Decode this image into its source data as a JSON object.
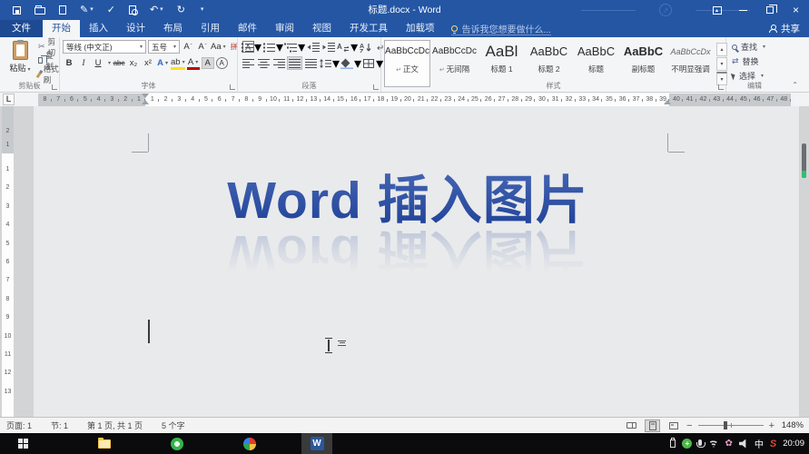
{
  "window": {
    "title": "标题.docx - Word",
    "qat_icons": [
      "save",
      "open",
      "new-document",
      "ink-signature",
      "spelling-check",
      "print-preview",
      "undo",
      "redo",
      "customize-quick-access"
    ],
    "controls": [
      "ribbon-display-options",
      "minimize",
      "restore-down",
      "close"
    ]
  },
  "tabs": {
    "file": "文件",
    "active": "开始",
    "items": [
      "开始",
      "插入",
      "设计",
      "布局",
      "引用",
      "邮件",
      "审阅",
      "视图",
      "开发工具",
      "加载项"
    ],
    "tell_me": "告诉我您想要做什么...",
    "share": "共享"
  },
  "ribbon": {
    "clipboard": {
      "label": "剪贴板",
      "paste": "粘贴",
      "cut": "剪切",
      "copy": "复制",
      "format_painter": "格式刷"
    },
    "font": {
      "label": "字体",
      "font_name": "等线 (中文正)",
      "font_size": "五号",
      "buttons": {
        "grow": "A",
        "shrink": "A",
        "change_case": "Aa",
        "phonetic": "拼",
        "char_border": "A",
        "bold": "B",
        "italic": "I",
        "underline": "U",
        "strikethrough": "abc",
        "subscript": "x₂",
        "superscript": "x²",
        "text_effects": "A",
        "highlight": "ab",
        "font_color": "A",
        "char_shading": "A",
        "enclose": "A"
      }
    },
    "paragraph": {
      "label": "段落"
    },
    "styles": {
      "label": "样式",
      "items": [
        {
          "preview": "AaBbCcDc",
          "name": "正文",
          "selected": true
        },
        {
          "preview": "AaBbCcDc",
          "name": "无间隔",
          "selected": false
        },
        {
          "preview": "AaBl",
          "name": "标题 1",
          "selected": false
        },
        {
          "preview": "AaBbC",
          "name": "标题 2",
          "selected": false
        },
        {
          "preview": "AaBbC",
          "name": "标题",
          "selected": false
        },
        {
          "preview": "AaBbC",
          "name": "副标题",
          "selected": false
        },
        {
          "preview": "AaBbCcDx",
          "name": "不明显强调",
          "selected": false
        }
      ]
    },
    "editing": {
      "label": "编辑",
      "find": "查找",
      "replace": "替换",
      "select": "选择"
    }
  },
  "ruler": {
    "left_margin": [
      8,
      7,
      6,
      5,
      4,
      3,
      2,
      1
    ],
    "text_area": [
      1,
      2,
      3,
      4,
      5,
      6,
      7,
      8,
      9,
      10,
      11,
      12,
      13,
      14,
      15,
      16,
      17,
      18,
      19,
      20,
      21,
      22,
      23,
      24,
      25,
      26,
      27,
      28,
      29,
      30,
      31,
      32,
      33,
      34,
      35,
      36,
      37,
      38,
      39
    ],
    "right_margin": [
      40,
      41,
      42,
      43,
      44,
      45,
      46,
      47,
      48
    ],
    "v_margin": [
      2,
      1
    ],
    "v_text": [
      1,
      2,
      3,
      4,
      5,
      6,
      7,
      8,
      9,
      10,
      11,
      12,
      13
    ]
  },
  "document": {
    "title": "Word 插入图片",
    "title_color_top": "#4b6cb8",
    "title_color_bottom": "#1d3f96"
  },
  "status": {
    "page_label": "页面: 1",
    "section": "节: 1",
    "pages": "第 1 页, 共 1 页",
    "words": "5 个字",
    "views": [
      "read-mode",
      "print-layout",
      "web-layout"
    ],
    "zoom_out": "−",
    "zoom_in": "+",
    "zoom": "148%"
  },
  "taskbar": {
    "apps": [
      "start",
      "file-explorer",
      "security-app",
      "browser",
      "word"
    ],
    "tray_icons": [
      "usb-device",
      "health-green-cross",
      "microphone",
      "wifi",
      "flower-app",
      "volume",
      "ime-chinese",
      "sogou"
    ],
    "ime": "中",
    "time": "20:09"
  },
  "colors": {
    "titlebar_blue": "#2456a4",
    "ribbon_bg": "#f4f5f7",
    "highlight_yellow": "#ffe400",
    "font_color_red": "#c00000",
    "taskbar_black": "#0b0b0d"
  }
}
